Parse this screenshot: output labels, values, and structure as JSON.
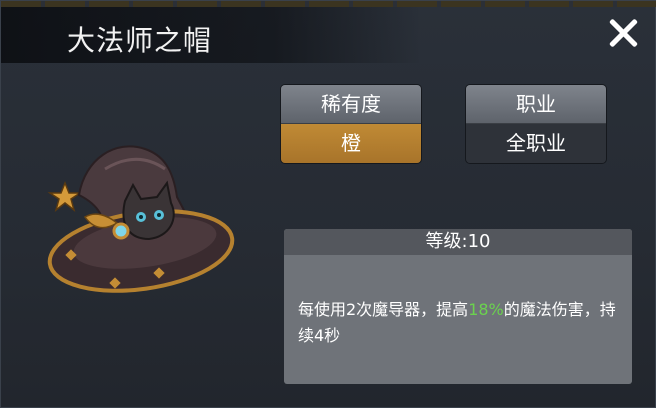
{
  "window": {
    "title": "大法师之帽"
  },
  "rarity": {
    "label": "稀有度",
    "value": "橙"
  },
  "job": {
    "label": "职业",
    "value": "全职业"
  },
  "level": {
    "text": "等级:10"
  },
  "description": {
    "before": "每使用2次魔导器，提高",
    "percent": "18%",
    "after": "的魔法伤害，持续4秒"
  },
  "item": {
    "icon": "witch-hat-cat-icon"
  },
  "colors": {
    "rarity_orange": "#b07b2d",
    "highlight_green": "#6bd24e"
  }
}
